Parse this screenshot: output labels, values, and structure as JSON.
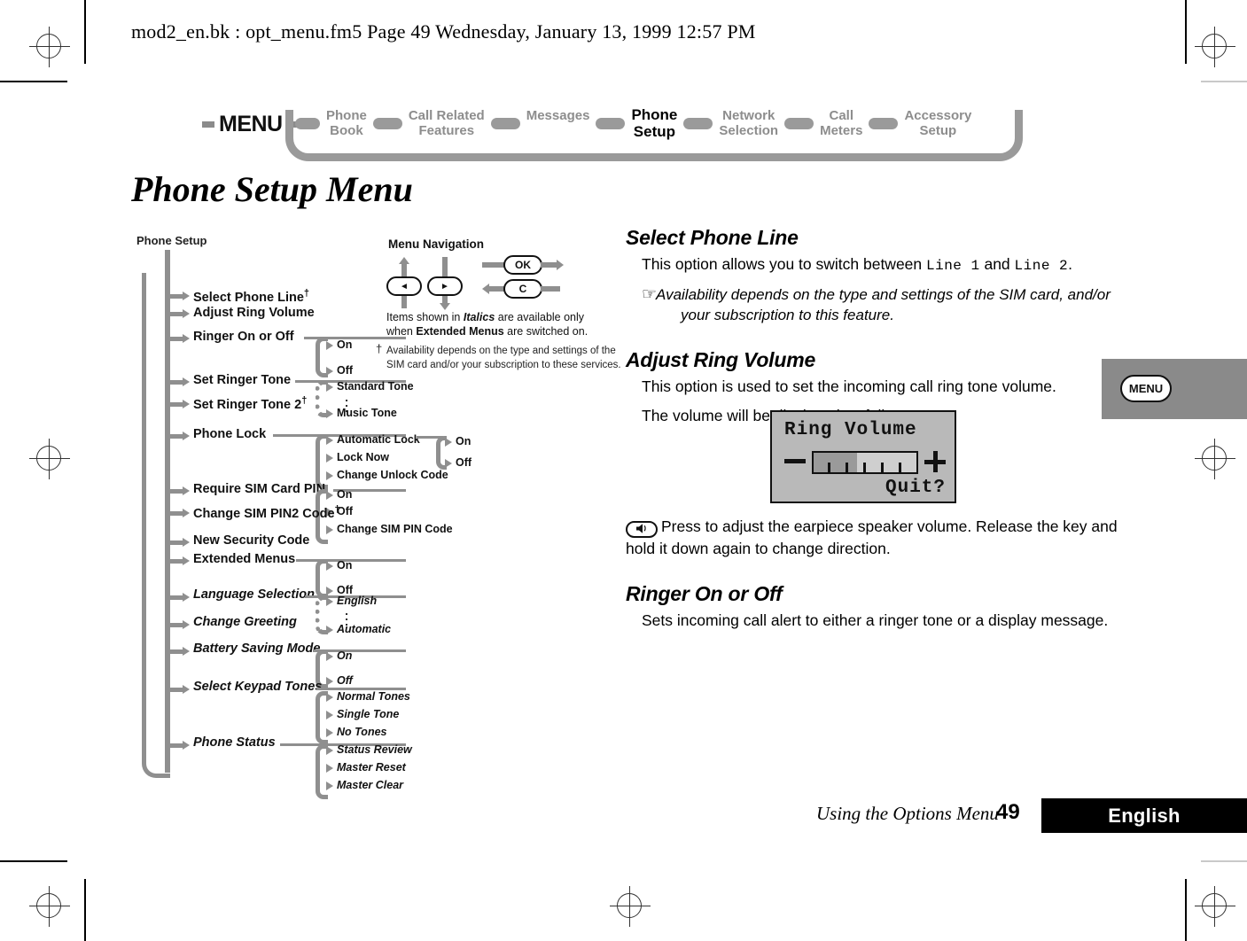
{
  "header": {
    "file_line": "mod2_en.bk : opt_menu.fm5  Page 49  Wednesday, January 13, 1999  12:57 PM"
  },
  "breadcrumb": {
    "menu_label": "MENU",
    "items": [
      {
        "line1": "Phone",
        "line2": "Book",
        "active": false
      },
      {
        "line1": "Call Related",
        "line2": "Features",
        "active": false
      },
      {
        "line1": "Messages",
        "line2": "",
        "active": false
      },
      {
        "line1": "Phone",
        "line2": "Setup",
        "active": true
      },
      {
        "line1": "Network",
        "line2": "Selection",
        "active": false
      },
      {
        "line1": "Call",
        "line2": "Meters",
        "active": false
      },
      {
        "line1": "Accessory",
        "line2": "Setup",
        "active": false
      }
    ]
  },
  "page": {
    "title": "Phone Setup Menu"
  },
  "diagram": {
    "heading": "Phone Setup",
    "nav_heading": "Menu Navigation",
    "keys": {
      "left": "◄",
      "right": "►",
      "ok": "OK",
      "clear": "C"
    },
    "note_italics_1": "Items shown in ",
    "note_italics_bold": "Italics",
    "note_italics_2": " are available only",
    "note_italics_3a": "when ",
    "note_italics_3b": "Extended Menus",
    "note_italics_3c": " are switched on.",
    "dagger_mark": "†",
    "note_dagger_1": "Availability depends on the type and settings of the",
    "note_dagger_2": "SIM card and/or your subscription to these services.",
    "tree": [
      {
        "label": "Select Phone Line",
        "dagger": true,
        "italic": false,
        "children": []
      },
      {
        "label": "Adjust Ring Volume",
        "dagger": false,
        "italic": false,
        "children": []
      },
      {
        "label": "Ringer On or Off",
        "dagger": false,
        "italic": false,
        "children": [
          "On",
          "Off"
        ]
      },
      {
        "label": "Set Ringer Tone",
        "dagger": false,
        "italic": false,
        "children": [
          "Standard Tone",
          "Music Tone"
        ]
      },
      {
        "label": "Set Ringer Tone 2",
        "dagger": true,
        "italic": false,
        "children": []
      },
      {
        "label": "Phone Lock",
        "dagger": false,
        "italic": false,
        "children": [
          "Automatic Lock",
          "Lock Now",
          "Change Unlock Code"
        ],
        "grandchildren": [
          "On",
          "Off"
        ]
      },
      {
        "label": "Require SIM Card PIN",
        "dagger": false,
        "italic": false,
        "children": [
          "On",
          "Off",
          "Change SIM PIN Code"
        ]
      },
      {
        "label": "Change SIM PIN2 Code",
        "dagger": true,
        "italic": false,
        "children": []
      },
      {
        "label": "New Security Code",
        "dagger": false,
        "italic": false,
        "children": []
      },
      {
        "label": "Extended Menus",
        "dagger": false,
        "italic": false,
        "children": [
          "On",
          "Off"
        ]
      },
      {
        "label": "Language Selection",
        "dagger": false,
        "italic": true,
        "children": [
          "English",
          "Automatic"
        ]
      },
      {
        "label": "Change Greeting",
        "dagger": false,
        "italic": true,
        "children": []
      },
      {
        "label": "Battery Saving Mode",
        "dagger": false,
        "italic": true,
        "children": [
          "On",
          "Off"
        ]
      },
      {
        "label": "Select Keypad Tones",
        "dagger": false,
        "italic": true,
        "children": [
          "Normal Tones",
          "Single Tone",
          "No Tones"
        ]
      },
      {
        "label": "Phone Status",
        "dagger": false,
        "italic": true,
        "children": [
          "Status Review",
          "Master Reset",
          "Master Clear"
        ]
      }
    ]
  },
  "content": {
    "sections": [
      {
        "heading": "Select Phone Line",
        "body_pre": "This option allows you to switch between ",
        "mono_1": "Line 1",
        "body_mid": " and ",
        "mono_2": "Line 2",
        "body_post": ".",
        "note_icon": "☞",
        "note": "Availability depends on the type and settings of the SIM card, and/or your subscription to this feature."
      },
      {
        "heading": "Adjust Ring Volume",
        "para1": "This option is used to set the incoming call ring tone volume.",
        "para2": "The volume will be displayed as follows:",
        "key_icon": "🔈",
        "para3": "Press to adjust the earpiece speaker volume. Release the key and hold it down again to change direction."
      },
      {
        "heading": "Ringer On or Off",
        "para1": "Sets incoming call alert to either a ringer tone or a display message."
      }
    ]
  },
  "lcd": {
    "title": "Ring Volume",
    "quit": "Quit?",
    "level_percent": 42,
    "minus": "−",
    "plus": "+"
  },
  "edge_tab": {
    "label": "MENU"
  },
  "footer": {
    "running_head": "Using the Options Menu",
    "page_number": "49",
    "language": "English"
  },
  "colors": {
    "tree_gray": "#8f8f8f",
    "breadcrumb_gray": "#9a9a9a",
    "inactive_text": "#8d8d8d",
    "lcd_bg": "#b9b9b9",
    "edge_tab": "#8a8a8a"
  }
}
